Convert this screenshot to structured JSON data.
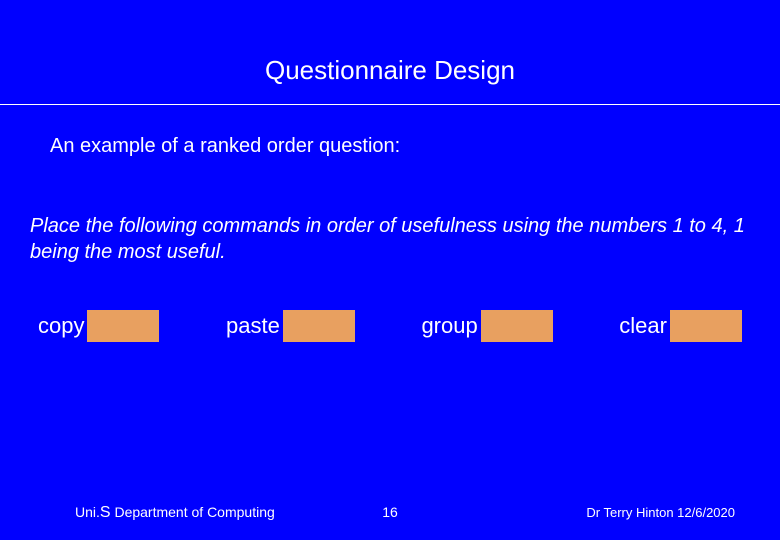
{
  "title": "Questionnaire Design",
  "intro": "An example of a ranked order question:",
  "instruction": "Place the following commands in order of usefulness using the numbers 1 to 4,  1 being the most useful.",
  "options": [
    {
      "label": "copy"
    },
    {
      "label": "paste"
    },
    {
      "label": "group"
    },
    {
      "label": "clear"
    }
  ],
  "footer": {
    "dept_prefix": "Uni.",
    "dept_s": "S",
    "dept_rest": " Department of Computing",
    "page": "16",
    "author_date": "Dr Terry Hinton 12/6/2020"
  }
}
